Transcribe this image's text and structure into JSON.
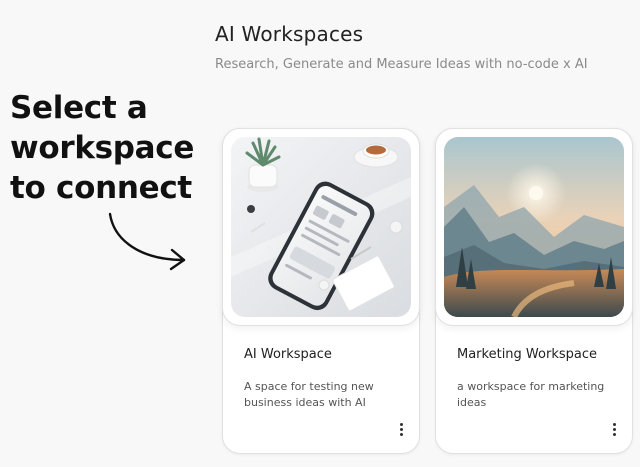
{
  "header": {
    "title": "AI Workspaces",
    "subtitle": "Research, Generate and Measure Ideas with no-code x AI"
  },
  "callout": {
    "line1": "Select a",
    "line2": "workspace",
    "line3": "to connect"
  },
  "workspaces": [
    {
      "name": "AI Workspace",
      "description": "A space for testing new business ideas with AI",
      "thumbnail": "phone-on-desk-illustration"
    },
    {
      "name": "Marketing Workspace",
      "description": "a workspace for marketing ideas",
      "thumbnail": "mountain-sunrise-illustration"
    }
  ],
  "icons": {
    "more": "more-vertical-icon",
    "arrow": "curved-arrow-icon"
  },
  "colors": {
    "background": "#f8f8f8",
    "card": "#ffffff",
    "card_border": "#e1e1e1"
  }
}
